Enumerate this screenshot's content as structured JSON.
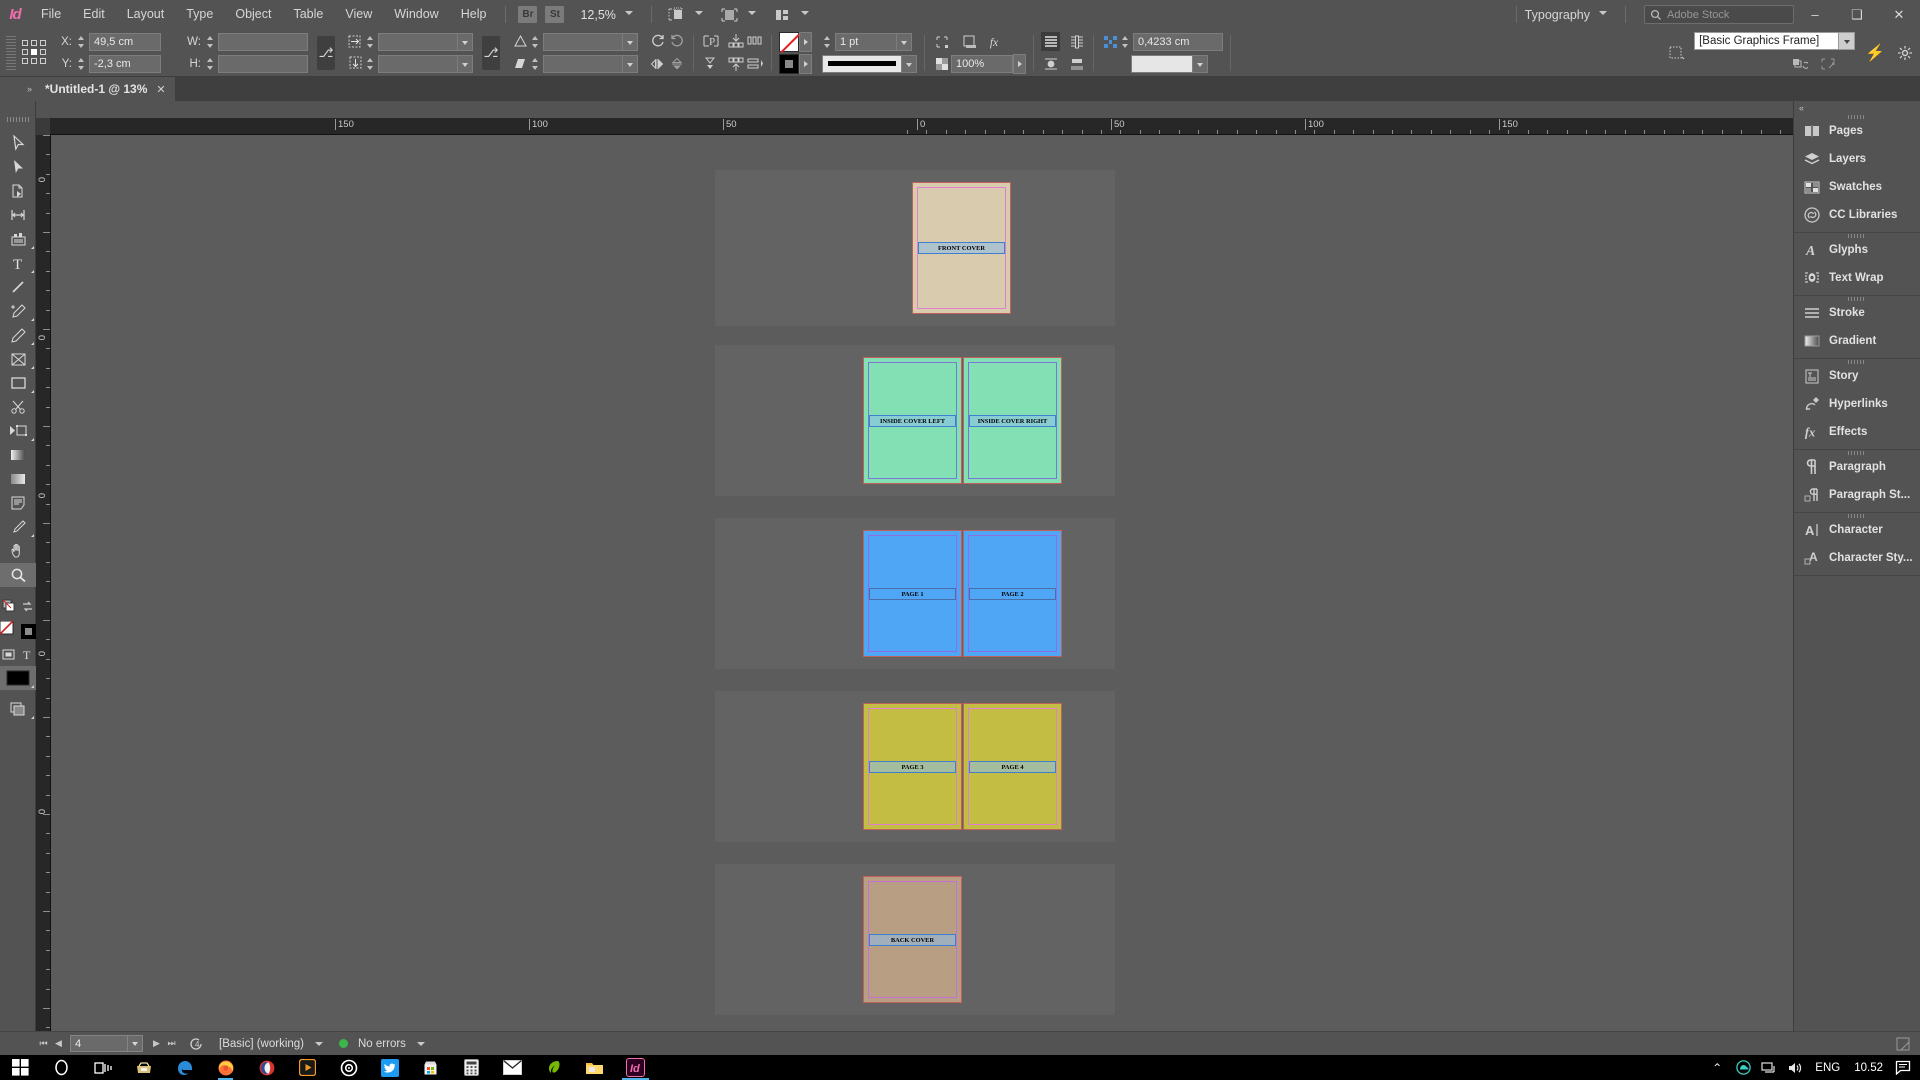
{
  "app": {
    "logo": "Id",
    "menus": [
      "File",
      "Edit",
      "Layout",
      "Type",
      "Object",
      "Table",
      "View",
      "Window",
      "Help"
    ],
    "bridge_btn": "Br",
    "stock_btn": "St",
    "zoom_level": "12,5%",
    "workspace": "Typography",
    "stock_placeholder": "Adobe Stock",
    "window_min": "–",
    "window_restore": "❑",
    "window_close": "✕"
  },
  "control_panel": {
    "x_label": "X:",
    "x_value": "49,5 cm",
    "y_label": "Y:",
    "y_value": "-2,3 cm",
    "w_label": "W:",
    "w_value": "",
    "h_label": "H:",
    "h_value": "",
    "scale_x": "",
    "scale_y": "",
    "rotate_value": "",
    "shear_value": "",
    "stroke_weight": "1 pt",
    "opacity": "100%",
    "gap_value": "0,4233 cm",
    "object_style": "[Basic Graphics Frame]",
    "chain_glyph": "⎇"
  },
  "document": {
    "tab_title": "*Untitled-1 @ 13%",
    "tab_close": "✕"
  },
  "toolbar": {
    "tools": [
      {
        "name": "selection-tool",
        "glyph": "selection"
      },
      {
        "name": "direct-selection-tool",
        "glyph": "direct-selection"
      },
      {
        "name": "page-tool",
        "glyph": "page"
      },
      {
        "name": "gap-tool",
        "glyph": "gap"
      },
      {
        "name": "content-collector-tool",
        "glyph": "collector"
      },
      {
        "name": "type-tool",
        "glyph": "type"
      },
      {
        "name": "line-tool",
        "glyph": "line"
      },
      {
        "name": "pen-tool",
        "glyph": "pen"
      },
      {
        "name": "pencil-tool",
        "glyph": "pencil"
      },
      {
        "name": "rectangle-frame-tool",
        "glyph": "frame"
      },
      {
        "name": "rectangle-tool",
        "glyph": "rect"
      },
      {
        "name": "scissors-tool",
        "glyph": "scissors"
      },
      {
        "name": "free-transform-tool",
        "glyph": "transform"
      },
      {
        "name": "gradient-swatch-tool",
        "glyph": "gradient"
      },
      {
        "name": "gradient-feather-tool",
        "glyph": "feather"
      },
      {
        "name": "note-tool",
        "glyph": "note"
      },
      {
        "name": "eyedropper-tool",
        "glyph": "eyedropper"
      },
      {
        "name": "hand-tool",
        "glyph": "hand"
      },
      {
        "name": "zoom-tool",
        "glyph": "zoom"
      }
    ]
  },
  "rulers": {
    "horizontal_labels": [
      "150",
      "100",
      "50",
      "0",
      "50",
      "100",
      "150"
    ],
    "vertical_labels": [
      "0",
      "0",
      "0",
      "0",
      "0"
    ],
    "units": "mm"
  },
  "spreads": [
    {
      "name": "front-cover-spread",
      "pages": [
        {
          "label": "FRONT COVER",
          "fill": "#d9cbae",
          "border": "#c0625a",
          "margin_color": "#e07fd0",
          "text_frame_style": "selected"
        }
      ]
    },
    {
      "name": "inside-cover-spread",
      "pages": [
        {
          "label": "INSIDE COVER LEFT",
          "fill": "#83dfb4",
          "border": "#c0625a",
          "margin_color": "#7a78d4",
          "text_frame_style": "selected"
        },
        {
          "label": "INSIDE COVER RIGHT",
          "fill": "#83dfb4",
          "border": "#c0625a",
          "margin_color": "#7a78d4",
          "text_frame_style": "selected"
        }
      ]
    },
    {
      "name": "page-1-2-spread",
      "pages": [
        {
          "label": "PAGE 1",
          "fill": "#4ea6f5",
          "border": "#c0625a",
          "margin_color": "#8d6fe0",
          "text_frame_style": "plain"
        },
        {
          "label": "PAGE 2",
          "fill": "#4ea6f5",
          "border": "#c0625a",
          "margin_color": "#8d6fe0",
          "text_frame_style": "plain"
        }
      ]
    },
    {
      "name": "page-3-4-spread",
      "pages": [
        {
          "label": "PAGE 3",
          "fill": "#c3bd43",
          "border": "#c0625a",
          "margin_color": "#e07fd0",
          "text_frame_style": "selected"
        },
        {
          "label": "PAGE 4",
          "fill": "#c3bd43",
          "border": "#c0625a",
          "margin_color": "#e07fd0",
          "text_frame_style": "selected"
        }
      ]
    },
    {
      "name": "back-cover-spread",
      "pages": [
        {
          "label": "BACK COVER",
          "fill": "#b89e82",
          "border": "#c0625a",
          "margin_color": "#c96fd8",
          "text_frame_style": "selected"
        }
      ]
    }
  ],
  "dock": {
    "groups": [
      {
        "items": [
          {
            "label": "Pages",
            "icon": "pages-icon"
          },
          {
            "label": "Layers",
            "icon": "layers-icon"
          },
          {
            "label": "Swatches",
            "icon": "swatches-icon"
          },
          {
            "label": "CC Libraries",
            "icon": "cc-libraries-icon"
          }
        ]
      },
      {
        "items": [
          {
            "label": "Glyphs",
            "icon": "glyphs-icon"
          },
          {
            "label": "Text Wrap",
            "icon": "text-wrap-icon"
          }
        ]
      },
      {
        "items": [
          {
            "label": "Stroke",
            "icon": "stroke-icon"
          },
          {
            "label": "Gradient",
            "icon": "gradient-icon"
          }
        ]
      },
      {
        "items": [
          {
            "label": "Story",
            "icon": "story-icon"
          },
          {
            "label": "Hyperlinks",
            "icon": "hyperlinks-icon"
          },
          {
            "label": "Effects",
            "icon": "effects-icon"
          }
        ]
      },
      {
        "items": [
          {
            "label": "Paragraph",
            "icon": "paragraph-icon"
          },
          {
            "label": "Paragraph St...",
            "icon": "paragraph-styles-icon"
          }
        ]
      },
      {
        "items": [
          {
            "label": "Character",
            "icon": "character-icon"
          },
          {
            "label": "Character Sty...",
            "icon": "character-styles-icon"
          }
        ]
      }
    ]
  },
  "status_bar": {
    "first_page": "⏮",
    "prev_page": "◀",
    "page_number": "4",
    "next_page": "▶",
    "last_page": "⏭",
    "preflight_profile": "[Basic] (working)",
    "error_status": "No errors",
    "status_color": "#3cb54a"
  },
  "taskbar": {
    "items": [
      {
        "name": "start-button",
        "icon": "windows-logo"
      },
      {
        "name": "cortana-search",
        "icon": "circle"
      },
      {
        "name": "task-view",
        "icon": "task-view"
      },
      {
        "name": "store-app",
        "icon": "box"
      },
      {
        "name": "edge-browser",
        "icon": "edge"
      },
      {
        "name": "firefox-browser",
        "icon": "firefox"
      },
      {
        "name": "opera-browser",
        "icon": "opera"
      },
      {
        "name": "media-player",
        "icon": "play"
      },
      {
        "name": "disc-app",
        "icon": "disc"
      },
      {
        "name": "twitter-app",
        "icon": "twitter"
      },
      {
        "name": "microsoft-store",
        "icon": "store"
      },
      {
        "name": "calculator-app",
        "icon": "calc"
      },
      {
        "name": "mail-app",
        "icon": "mail"
      },
      {
        "name": "nvidia-app",
        "icon": "leaf"
      },
      {
        "name": "file-explorer",
        "icon": "folder"
      },
      {
        "name": "indesign-app",
        "icon": "indesign"
      }
    ],
    "tray": {
      "show_hidden": "⌃",
      "language": "ENG",
      "clock": "10.52"
    }
  }
}
